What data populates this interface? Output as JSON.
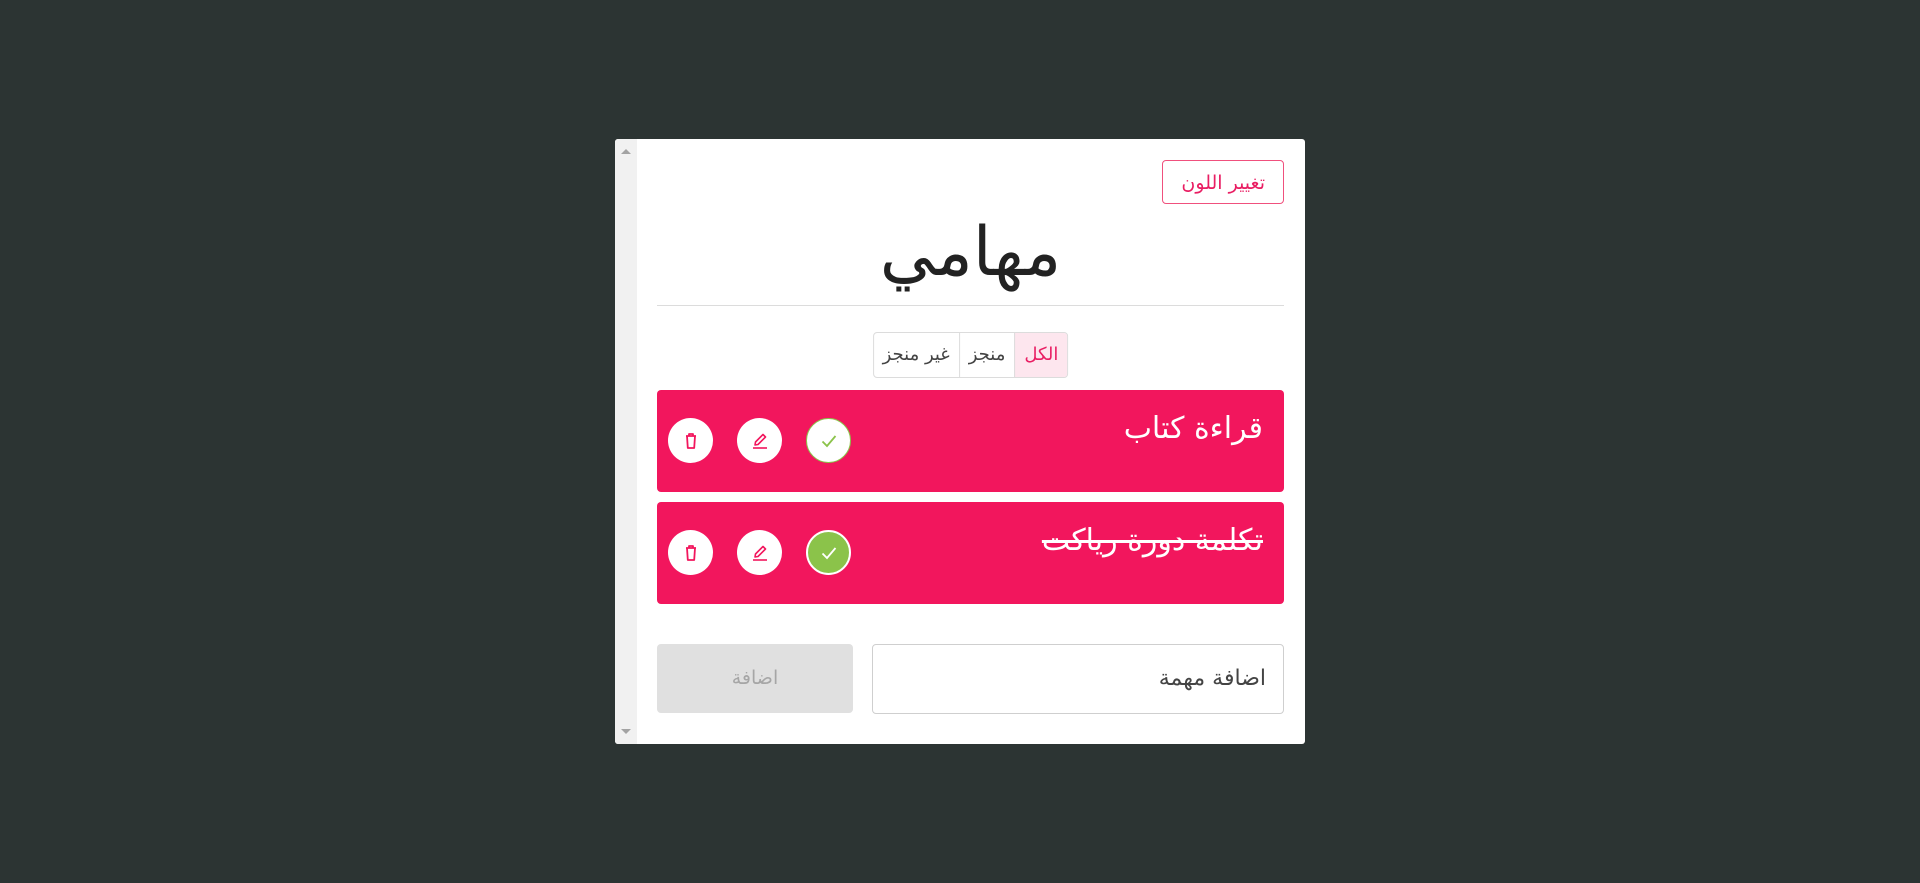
{
  "header": {
    "change_color_label": "تغيير اللون",
    "title": "مهامي"
  },
  "filters": [
    {
      "label": "الكل",
      "active": true
    },
    {
      "label": "منجز",
      "active": false
    },
    {
      "label": "غير منجز",
      "active": false
    }
  ],
  "tasks": [
    {
      "text": "قراءة كتاب",
      "done": false
    },
    {
      "text": "تكلمة دورة رياكت",
      "done": true
    }
  ],
  "add_task": {
    "placeholder": "اضافة مهمة",
    "button_label": "اضافة"
  },
  "icons": {
    "check": "check-icon",
    "edit": "pencil-icon",
    "delete": "trash-icon"
  },
  "colors": {
    "accent": "#f2165d",
    "done_green": "#8bc34a",
    "background": "#2c3433"
  }
}
